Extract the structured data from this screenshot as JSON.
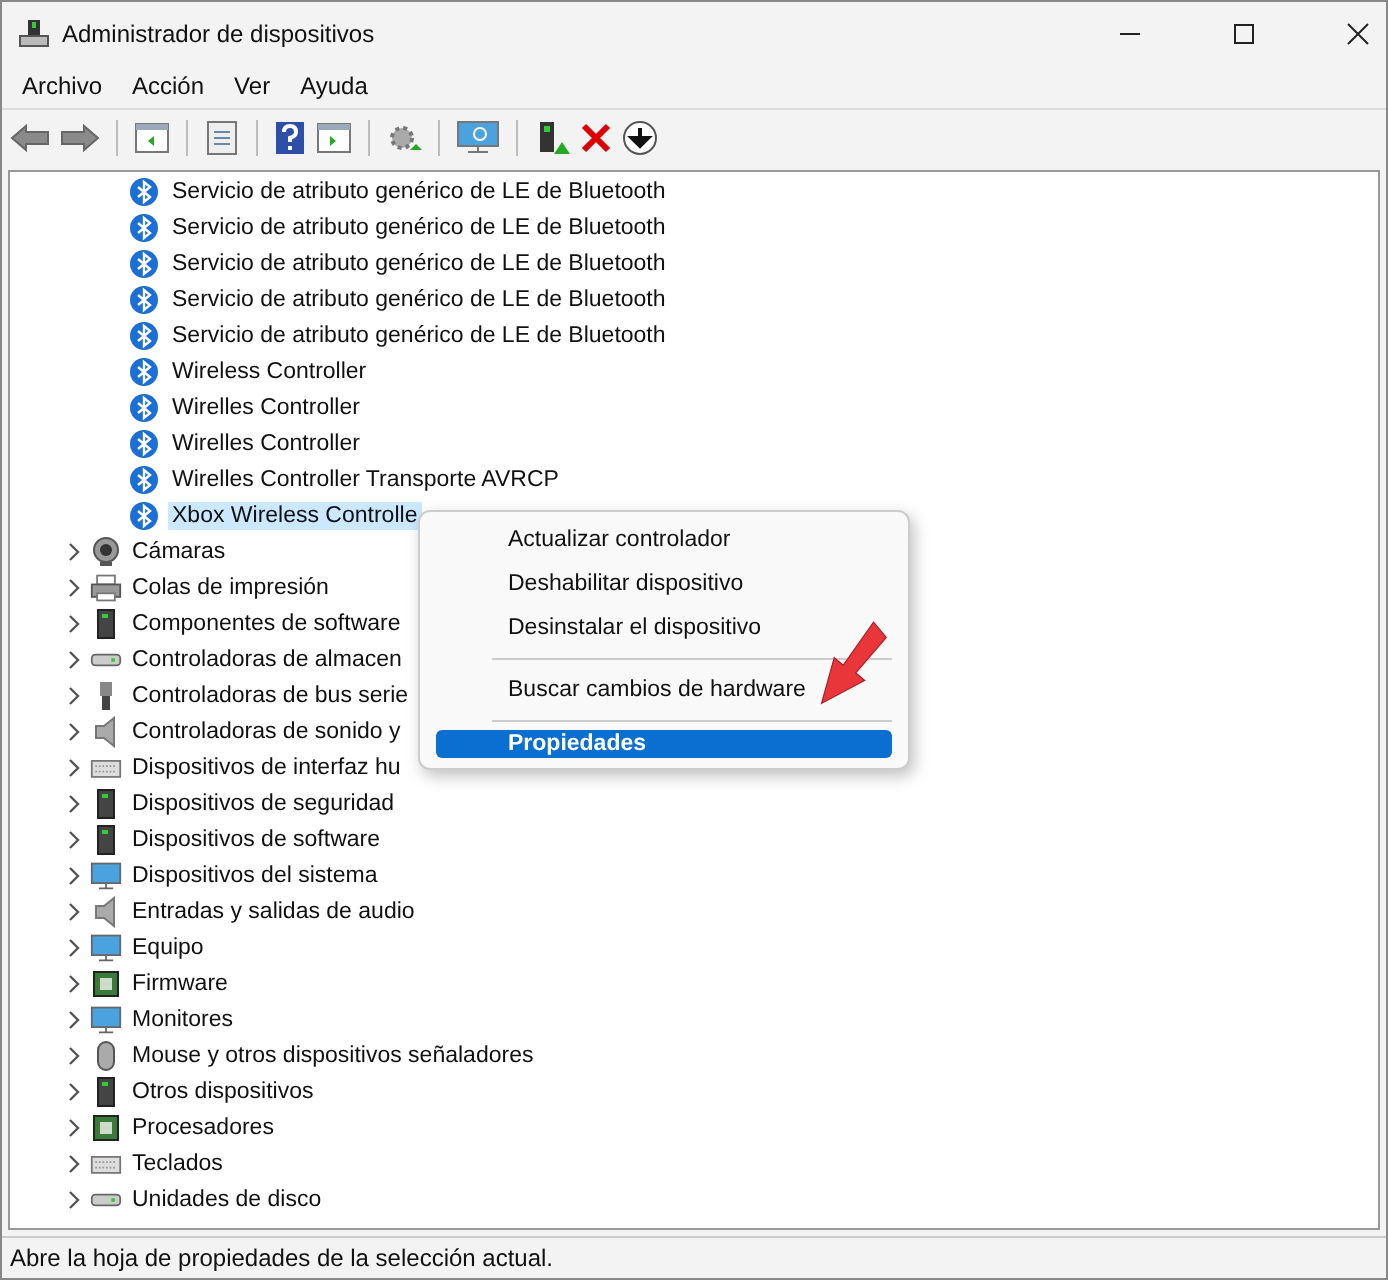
{
  "window": {
    "title": "Administrador de dispositivos"
  },
  "menu": [
    "Archivo",
    "Acción",
    "Ver",
    "Ayuda"
  ],
  "tree": {
    "devices": [
      {
        "label": "Servicio de atributo genérico de LE de Bluetooth",
        "selected": false
      },
      {
        "label": "Servicio de atributo genérico de LE de Bluetooth",
        "selected": false
      },
      {
        "label": "Servicio de atributo genérico de LE de Bluetooth",
        "selected": false
      },
      {
        "label": "Servicio de atributo genérico de LE de Bluetooth",
        "selected": false
      },
      {
        "label": "Servicio de atributo genérico de LE de Bluetooth",
        "selected": false
      },
      {
        "label": "Wireless Controller",
        "selected": false
      },
      {
        "label": "Wirelles Controller",
        "selected": false
      },
      {
        "label": "Wirelles Controller",
        "selected": false
      },
      {
        "label": "Wirelles Controller Transporte AVRCP",
        "selected": false
      },
      {
        "label": "Xbox Wireless Controlle",
        "selected": true
      }
    ],
    "categories": [
      {
        "label": "Cámaras",
        "expanded": false
      },
      {
        "label": "Colas de impresión",
        "expanded": false
      },
      {
        "label": "Componentes de software",
        "expanded": false
      },
      {
        "label": "Controladoras de almacen",
        "expanded": false
      },
      {
        "label": "Controladoras de bus serie",
        "expanded": false
      },
      {
        "label": "Controladoras de sonido y",
        "expanded": false
      },
      {
        "label": "Dispositivos de interfaz hu",
        "expanded": false
      },
      {
        "label": "Dispositivos de seguridad",
        "expanded": false
      },
      {
        "label": "Dispositivos de software",
        "expanded": false
      },
      {
        "label": "Dispositivos del sistema",
        "expanded": false
      },
      {
        "label": "Entradas y salidas de audio",
        "expanded": false
      },
      {
        "label": "Equipo",
        "expanded": false
      },
      {
        "label": "Firmware",
        "expanded": false
      },
      {
        "label": "Monitores",
        "expanded": false
      },
      {
        "label": "Mouse y otros dispositivos señaladores",
        "expanded": false
      },
      {
        "label": "Otros dispositivos",
        "expanded": false
      },
      {
        "label": "Procesadores",
        "expanded": false
      },
      {
        "label": "Teclados",
        "expanded": false
      },
      {
        "label": "Unidades de disco",
        "expanded": false
      }
    ]
  },
  "context_menu": [
    {
      "kind": "item",
      "label": "Actualizar controlador",
      "selected": false
    },
    {
      "kind": "item",
      "label": "Deshabilitar dispositivo",
      "selected": false
    },
    {
      "kind": "item",
      "label": "Desinstalar el dispositivo",
      "selected": false
    },
    {
      "kind": "separator"
    },
    {
      "kind": "item",
      "label": "Buscar cambios de hardware",
      "selected": false
    },
    {
      "kind": "separator"
    },
    {
      "kind": "item",
      "label": "Propiedades",
      "selected": true
    }
  ],
  "status_bar": "Abre la hoja de propiedades de la selección actual."
}
